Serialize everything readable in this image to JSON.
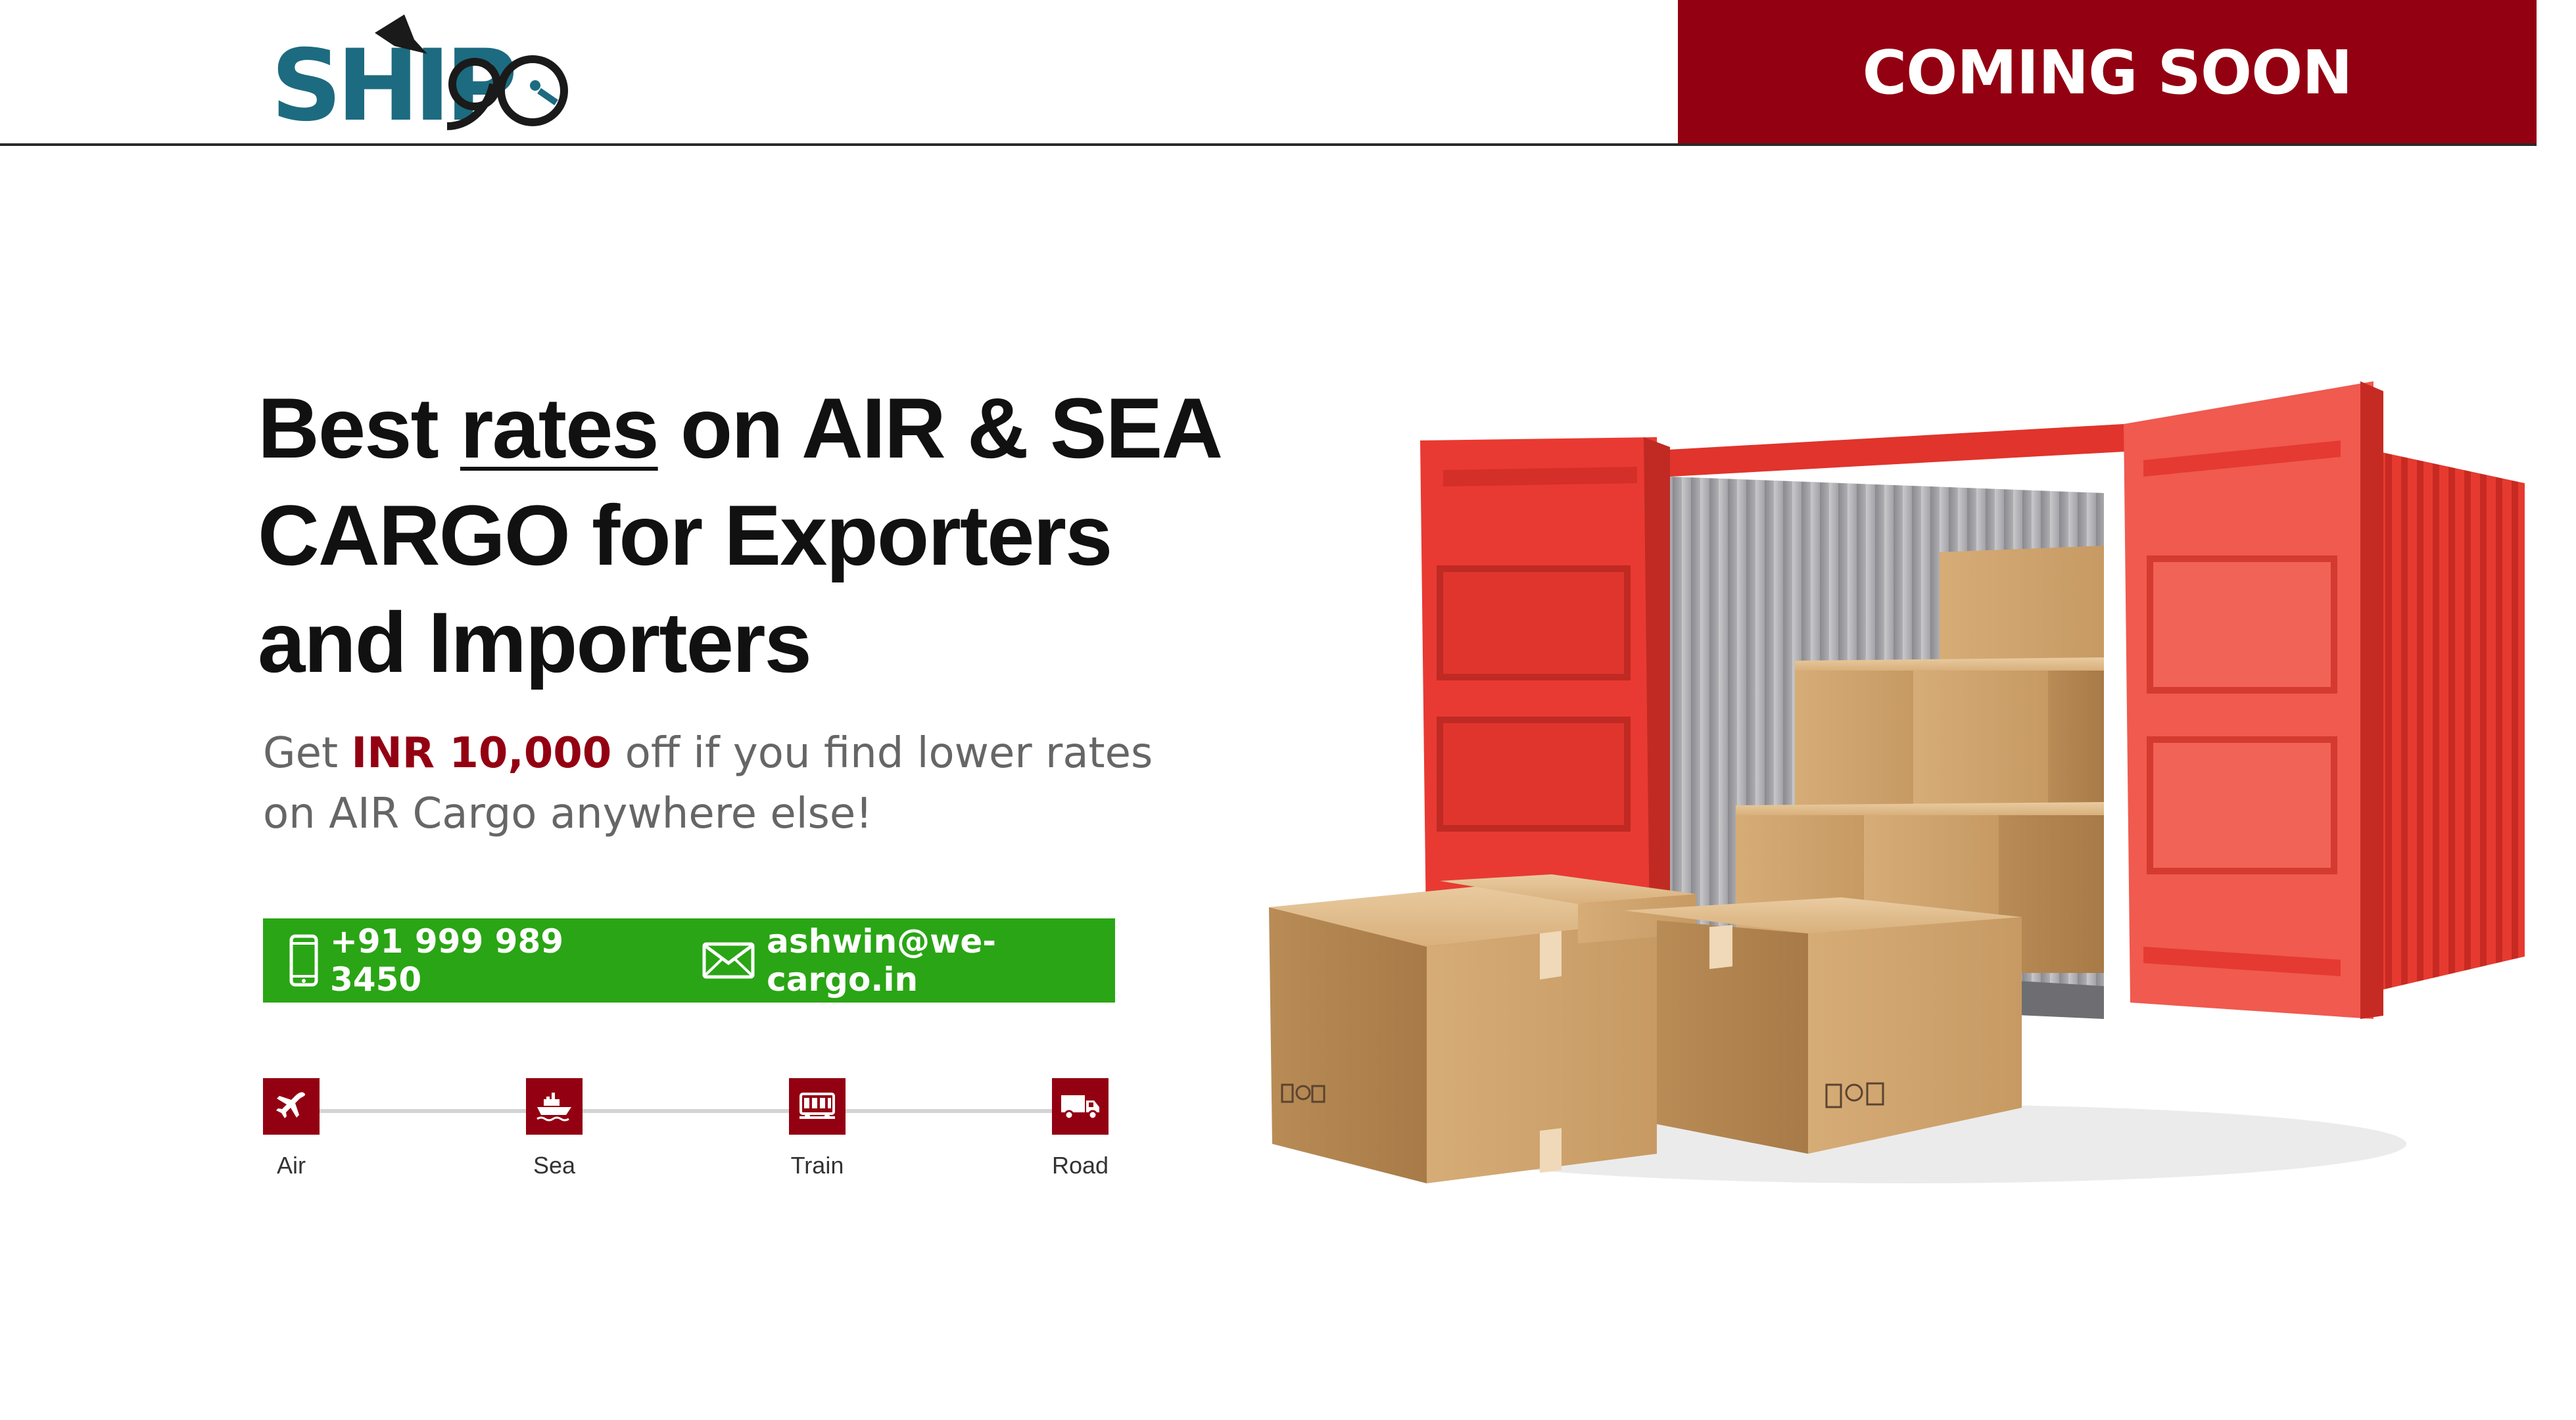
{
  "header": {
    "logo_text": "SHIP90",
    "coming_soon": "COMING SOON"
  },
  "hero": {
    "headline_part1": "Best ",
    "headline_underlined": "rates",
    "headline_part2": " on AIR & SEA CARGO for Exporters and Importers",
    "sub_prefix": "Get ",
    "sub_highlight": "INR 10,000",
    "sub_suffix": " off if you find lower rates on AIR Cargo anywhere else!"
  },
  "contact": {
    "phone": "+91 999 989 3450",
    "email": "ashwin@we-cargo.in"
  },
  "modes": [
    {
      "label": "Air",
      "icon": "airplane-icon"
    },
    {
      "label": "Sea",
      "icon": "ship-icon"
    },
    {
      "label": "Train",
      "icon": "train-icon"
    },
    {
      "label": "Road",
      "icon": "truck-icon"
    }
  ],
  "colors": {
    "brand_red": "#930012",
    "contact_green": "#2aa515",
    "logo_teal": "#1d6b80",
    "container_red": "#e8302c"
  }
}
